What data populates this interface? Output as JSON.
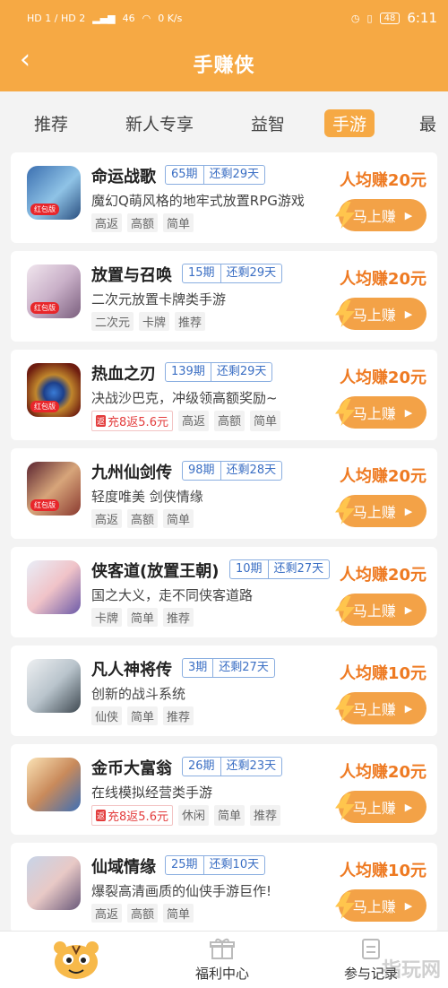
{
  "status": {
    "sim1": "HD 1",
    "sim2": "HD 2",
    "net": "46",
    "speed": "0 K/s",
    "battery": "48",
    "time": "6:11"
  },
  "header": {
    "title": "手赚侠"
  },
  "tabs": [
    "推荐",
    "新人专享",
    "益智",
    "手游",
    "最"
  ],
  "cta_label": "马上赚",
  "games": [
    {
      "name": "命运战歌",
      "period": "65期",
      "remain": "还剩29天",
      "desc": "魔幻Q萌风格的地牢式放置RPG游戏",
      "tags": [
        "高返",
        "高额",
        "简单"
      ],
      "rebate": "",
      "earn": "人均赚20元",
      "badge": "红包版"
    },
    {
      "name": "放置与召唤",
      "period": "15期",
      "remain": "还剩29天",
      "desc": "二次元放置卡牌类手游",
      "tags": [
        "二次元",
        "卡牌",
        "推荐"
      ],
      "rebate": "",
      "earn": "人均赚20元",
      "badge": "红包版"
    },
    {
      "name": "热血之刃",
      "period": "139期",
      "remain": "还剩29天",
      "desc": "决战沙巴克，冲级领高额奖励~",
      "tags": [
        "高返",
        "高额",
        "简单"
      ],
      "rebate": "充8返5.6元",
      "earn": "人均赚20元",
      "badge": "红包版"
    },
    {
      "name": "九州仙剑传",
      "period": "98期",
      "remain": "还剩28天",
      "desc": "轻度唯美 剑侠情缘",
      "tags": [
        "高返",
        "高额",
        "简单"
      ],
      "rebate": "",
      "earn": "人均赚20元",
      "badge": "红包版"
    },
    {
      "name": "侠客道(放置王朝)",
      "period": "10期",
      "remain": "还剩27天",
      "desc": "国之大义，走不同侠客道路",
      "tags": [
        "卡牌",
        "简单",
        "推荐"
      ],
      "rebate": "",
      "earn": "人均赚20元",
      "badge": ""
    },
    {
      "name": "凡人神将传",
      "period": "3期",
      "remain": "还剩27天",
      "desc": "创新的战斗系统",
      "tags": [
        "仙侠",
        "简单",
        "推荐"
      ],
      "rebate": "",
      "earn": "人均赚10元",
      "badge": ""
    },
    {
      "name": "金币大富翁",
      "period": "26期",
      "remain": "还剩23天",
      "desc": "在线模拟经营类手游",
      "tags": [
        "休闲",
        "简单",
        "推荐"
      ],
      "rebate": "充8返5.6元",
      "earn": "人均赚20元",
      "badge": ""
    },
    {
      "name": "仙域情缘",
      "period": "25期",
      "remain": "还剩10天",
      "desc": "爆裂高清画质的仙侠手游巨作!",
      "tags": [
        "高返",
        "高额",
        "简单"
      ],
      "rebate": "",
      "earn": "人均赚10元",
      "badge": ""
    }
  ],
  "rebate_icon_char": "返",
  "bottom_nav": {
    "welfare": "福利中心",
    "records": "参与记录"
  },
  "watermark": "指玩网",
  "colors": {
    "brand": "#f6a944",
    "earn": "#ee7a22",
    "cta": "#f3a247",
    "period_border": "#8aaee0"
  }
}
